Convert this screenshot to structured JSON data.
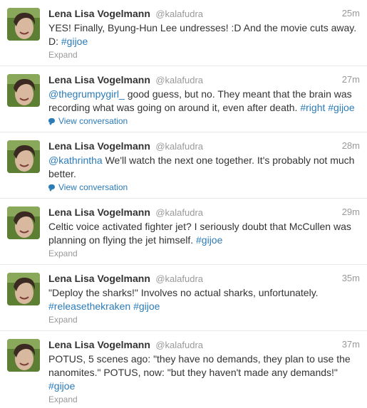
{
  "tweets": [
    {
      "fullname": "Lena Lisa Vogelmann",
      "username": "@kalafudra",
      "time": "25m",
      "text_parts": [
        "YES! Finally, Byung-Hun Lee undresses! :D And the movie cuts away. D: ",
        "#gijoe"
      ],
      "action": "Expand"
    },
    {
      "fullname": "Lena Lisa Vogelmann",
      "username": "@kalafudra",
      "time": "27m",
      "text_parts": [
        "@thegrumpygirl_",
        " good guess, but no. They meant that the brain was recording what was going on around it, even after death. ",
        "#right",
        " ",
        "#gijoe"
      ],
      "action": "View conversation"
    },
    {
      "fullname": "Lena Lisa Vogelmann",
      "username": "@kalafudra",
      "time": "28m",
      "text_parts": [
        "@kathrintha",
        " We'll watch the next one together. It's probably not much better."
      ],
      "action": "View conversation"
    },
    {
      "fullname": "Lena Lisa Vogelmann",
      "username": "@kalafudra",
      "time": "29m",
      "text_parts": [
        "Celtic voice activated fighter jet? I seriously doubt that McCullen was planning on flying the jet himself. ",
        "#gijoe"
      ],
      "action": "Expand"
    },
    {
      "fullname": "Lena Lisa Vogelmann",
      "username": "@kalafudra",
      "time": "35m",
      "text_parts": [
        "\"Deploy the sharks!\" Involves no actual sharks, unfortunately. ",
        "#releasethekraken",
        " ",
        "#gijoe"
      ],
      "action": "Expand"
    },
    {
      "fullname": "Lena Lisa Vogelmann",
      "username": "@kalafudra",
      "time": "37m",
      "text_parts": [
        "POTUS, 5 scenes ago: \"they have no demands, they plan to use the nanomites.\" POTUS, now: \"but they haven't made any demands!\" ",
        "#gijoe"
      ],
      "action": "Expand"
    }
  ],
  "icons": {
    "avatar": "profile-photo",
    "conversation": "speech-bubble-icon"
  },
  "colors": {
    "link": "#2b7bb9",
    "meta": "#999999",
    "text": "#333333"
  }
}
